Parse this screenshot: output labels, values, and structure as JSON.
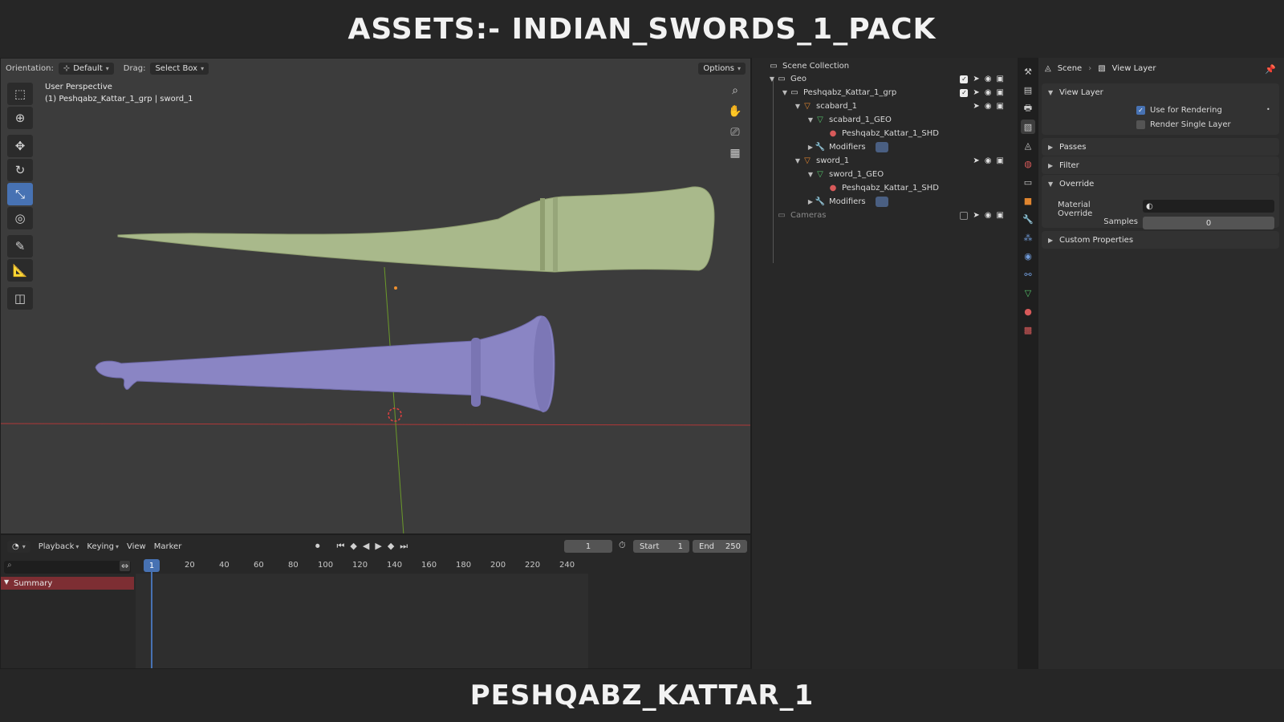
{
  "banner": {
    "top": "ASSETS:- INDIAN_SWORDS_1_PACK",
    "bottom": "PESHQABZ_KATTAR_1"
  },
  "viewport": {
    "orientation_label": "Orientation:",
    "orientation_value": "Default",
    "drag_label": "Drag:",
    "drag_value": "Select Box",
    "options_label": "Options",
    "view_name": "User Perspective",
    "selection_info": "(1) Peshqabz_Kattar_1_grp | sword_1",
    "colors": {
      "scabbard": "#a9b98b",
      "sword": "#8a85c4",
      "background": "#3c3c3c"
    }
  },
  "timeline": {
    "menus": [
      "Playback",
      "Keying",
      "View",
      "Marker"
    ],
    "current_frame": "1",
    "start_label": "Start",
    "start_value": "1",
    "end_label": "End",
    "end_value": "250",
    "ruler_ticks": [
      "20",
      "40",
      "60",
      "80",
      "100",
      "120",
      "140",
      "160",
      "180",
      "200",
      "220",
      "240"
    ],
    "frame_marker": "1",
    "summary_label": "Summary"
  },
  "outliner": {
    "root": "Scene Collection",
    "items": [
      {
        "label": "Geo",
        "icon": "collection-icon"
      },
      {
        "label": "Peshqabz_Kattar_1_grp",
        "icon": "collection-icon"
      },
      {
        "label": "scabard_1",
        "icon": "empty-object-icon"
      },
      {
        "label": "scabard_1_GEO",
        "icon": "mesh-data-icon"
      },
      {
        "label": "Peshqabz_Kattar_1_SHD",
        "icon": "material-icon"
      },
      {
        "label": "Modifiers",
        "icon": "wrench-icon"
      },
      {
        "label": "sword_1",
        "icon": "empty-object-icon"
      },
      {
        "label": "sword_1_GEO",
        "icon": "mesh-data-icon"
      },
      {
        "label": "Peshqabz_Kattar_1_SHD",
        "icon": "material-icon"
      },
      {
        "label": "Modifiers",
        "icon": "wrench-icon"
      },
      {
        "label": "Cameras",
        "icon": "collection-icon"
      }
    ]
  },
  "properties": {
    "breadcrumb_scene": "Scene",
    "breadcrumb_layer": "View Layer",
    "view_layer_panel": "View Layer",
    "use_for_rendering": "Use for Rendering",
    "render_single_layer": "Render Single Layer",
    "passes_panel": "Passes",
    "filter_panel": "Filter",
    "override_panel": "Override",
    "material_override_label": "Material Override",
    "samples_label": "Samples",
    "samples_value": "0",
    "custom_properties_panel": "Custom Properties"
  }
}
